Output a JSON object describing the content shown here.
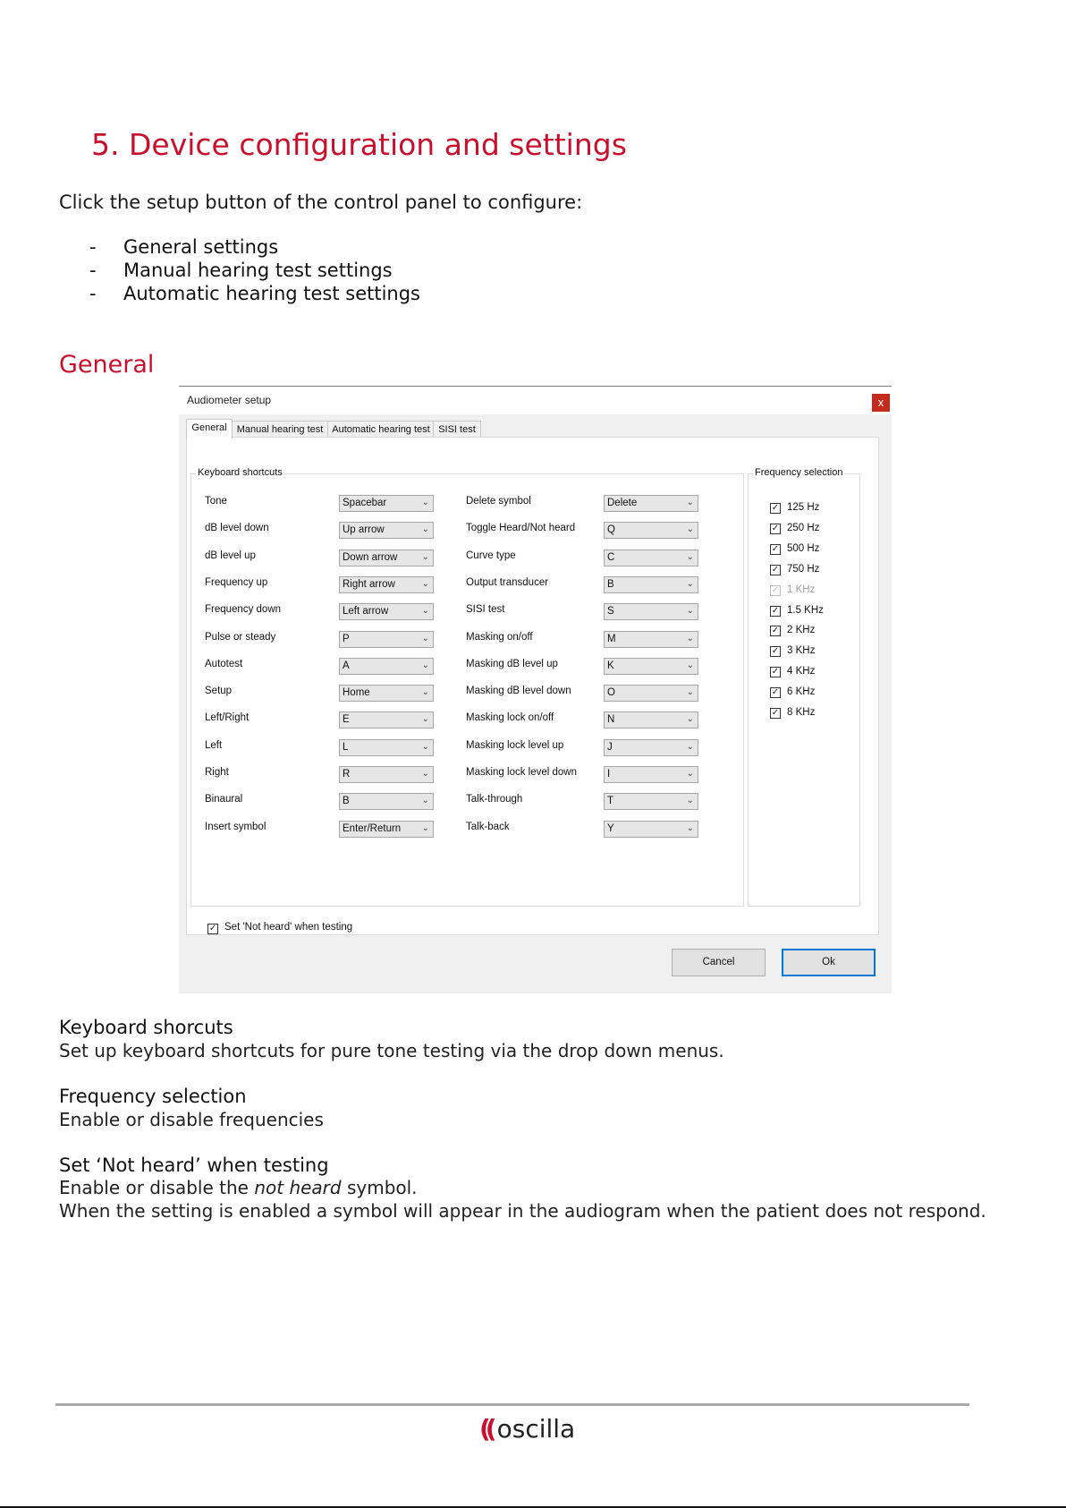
{
  "heading": "5. Device configuration and settings",
  "intro": "Click the setup button of the control panel to configure:",
  "bullets": [
    "General settings",
    "Manual hearing test settings",
    "Automatic hearing test settings"
  ],
  "bullet_marker": "-",
  "section_title": "General",
  "dialog": {
    "title": "Audiometer setup",
    "close": "x",
    "tabs": [
      "General",
      "Manual hearing test",
      "Automatic hearing test",
      "SISI test"
    ],
    "keyboard_group": "Keyboard shortcuts",
    "frequency_group": "Frequency selection",
    "shortcuts_left": [
      {
        "label": "Tone",
        "value": "Spacebar"
      },
      {
        "label": "dB level down",
        "value": "Up arrow"
      },
      {
        "label": "dB level up",
        "value": "Down arrow"
      },
      {
        "label": "Frequency up",
        "value": "Right arrow"
      },
      {
        "label": "Frequency down",
        "value": "Left arrow"
      },
      {
        "label": "Pulse or steady",
        "value": "P"
      },
      {
        "label": "Autotest",
        "value": "A"
      },
      {
        "label": "Setup",
        "value": "Home"
      },
      {
        "label": "Left/Right",
        "value": "E"
      },
      {
        "label": "Left",
        "value": "L"
      },
      {
        "label": "Right",
        "value": "R"
      },
      {
        "label": "Binaural",
        "value": "B"
      },
      {
        "label": "Insert symbol",
        "value": "Enter/Return"
      }
    ],
    "shortcuts_right": [
      {
        "label": "Delete symbol",
        "value": "Delete"
      },
      {
        "label": "Toggle Heard/Not heard",
        "value": "Q"
      },
      {
        "label": "Curve type",
        "value": "C"
      },
      {
        "label": "Output transducer",
        "value": "B"
      },
      {
        "label": "SISI test",
        "value": "S"
      },
      {
        "label": "Masking on/off",
        "value": "M"
      },
      {
        "label": "Masking dB level up",
        "value": "K"
      },
      {
        "label": "Masking dB level down",
        "value": "O"
      },
      {
        "label": "Masking lock on/off",
        "value": "N"
      },
      {
        "label": "Masking lock level up",
        "value": "J"
      },
      {
        "label": "Masking lock level down",
        "value": "I"
      },
      {
        "label": "Talk-through",
        "value": "T"
      },
      {
        "label": "Talk-back",
        "value": "Y"
      }
    ],
    "frequencies": [
      {
        "label": "125 Hz",
        "checked": true,
        "enabled": true
      },
      {
        "label": "250 Hz",
        "checked": true,
        "enabled": true
      },
      {
        "label": "500 Hz",
        "checked": true,
        "enabled": true
      },
      {
        "label": "750 Hz",
        "checked": true,
        "enabled": true
      },
      {
        "label": "1 KHz",
        "checked": true,
        "enabled": false
      },
      {
        "label": "1.5 KHz",
        "checked": true,
        "enabled": true
      },
      {
        "label": "2 KHz",
        "checked": true,
        "enabled": true
      },
      {
        "label": "3 KHz",
        "checked": true,
        "enabled": true
      },
      {
        "label": "4 KHz",
        "checked": true,
        "enabled": true
      },
      {
        "label": "6 KHz",
        "checked": true,
        "enabled": true
      },
      {
        "label": "8 KHz",
        "checked": true,
        "enabled": true
      }
    ],
    "not_heard_option": "Set 'Not heard' when testing",
    "cancel": "Cancel",
    "ok": "Ok"
  },
  "sections": {
    "keyboard_title": "Keyboard shorcuts",
    "keyboard_desc": "Set up keyboard shortcuts for pure tone testing via the drop down menus.",
    "frequency_title": "Frequency selection",
    "frequency_desc": "Enable or disable frequencies",
    "notheard_title": "Set ‘Not heard’ when testing",
    "notheard_desc_pre": "Enable or disable the ",
    "notheard_desc_em": "not heard",
    "notheard_desc_post": " symbol.",
    "notheard_desc2": "When the setting is enabled a symbol will appear in the audiogram when the patient does not respond."
  },
  "logo": "oscilla"
}
